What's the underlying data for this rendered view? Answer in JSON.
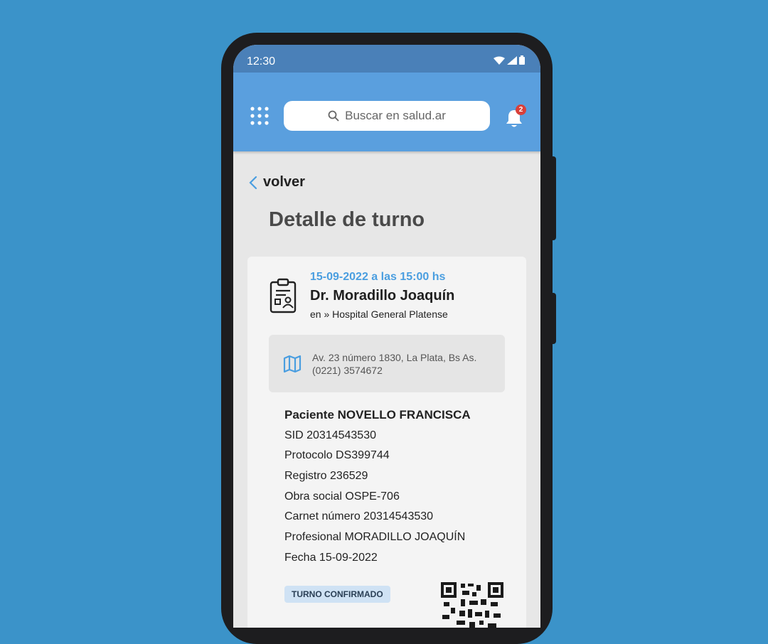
{
  "status_bar": {
    "time": "12:30"
  },
  "header": {
    "apps_icon": "grid-icon",
    "search_placeholder": "Buscar en salud.ar",
    "notifications_count": "2"
  },
  "nav": {
    "back_label": "volver"
  },
  "page": {
    "title": "Detalle de turno"
  },
  "appointment": {
    "datetime": "15-09-2022 a las 15:00 hs",
    "doctor": "Dr. Moradillo Joaquín",
    "location": "en » Hospital General Platense",
    "address": "Av. 23 número 1830, La Plata, Bs As.",
    "phone": "(0221) 3574672",
    "details": [
      "Paciente NOVELLO FRANCISCA",
      "SID 20314543530",
      "Protocolo DS399744",
      "Registro 236529",
      "Obra social OSPE-706",
      "Carnet número 20314543530",
      "Profesional MORADILLO JOAQUÍN",
      "Fecha 15-09-2022"
    ],
    "status": "TURNO CONFIRMADO"
  },
  "colors": {
    "background": "#3b93c9",
    "header": "#5a9fde",
    "status_bar": "#4a80b8",
    "accent_date": "#4a9ee0",
    "badge": "#d9403a",
    "status_badge": "#cfe2f4"
  }
}
